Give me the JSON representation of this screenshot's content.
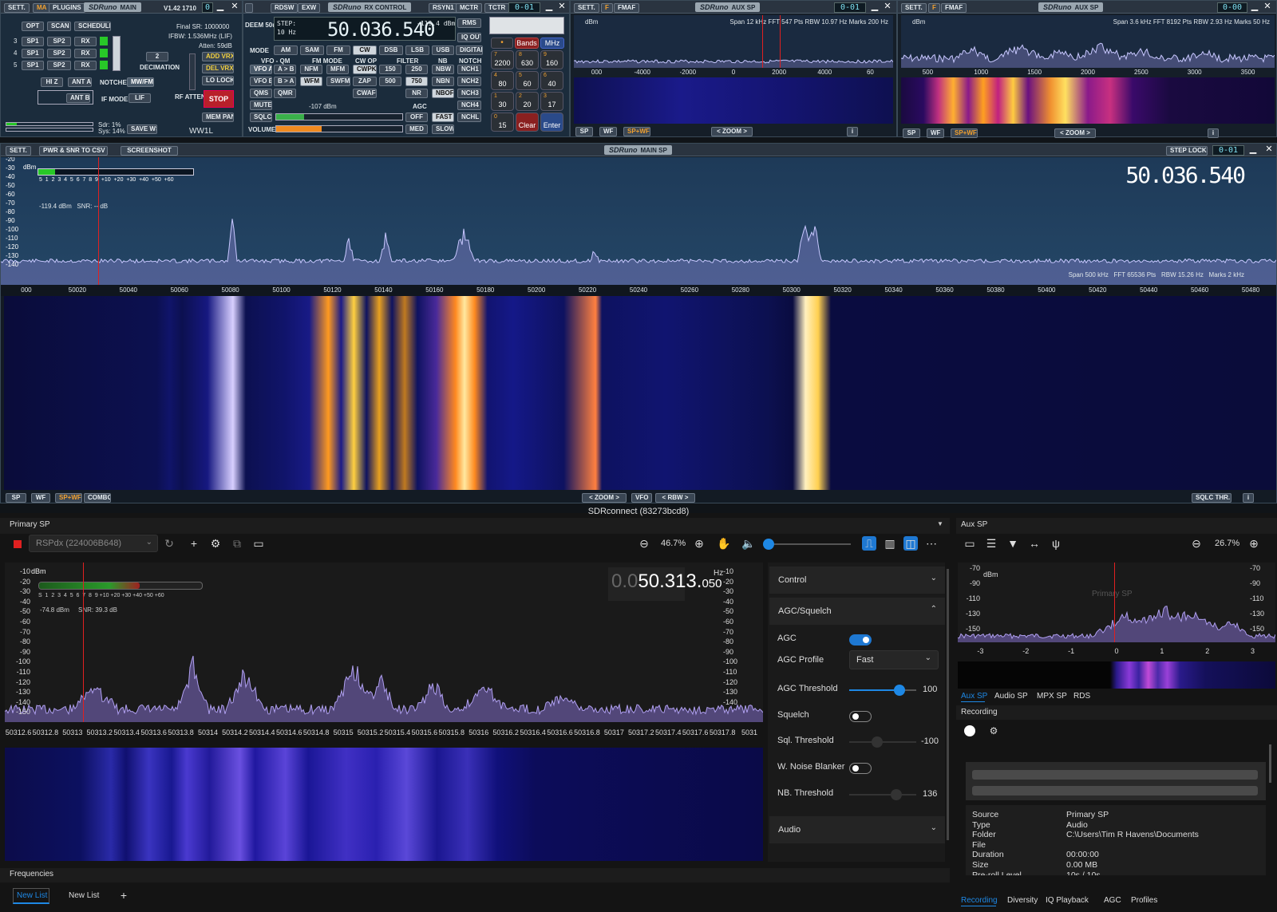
{
  "main": {
    "sett": "SETT.",
    "ma": "MA",
    "plugins": "PLUGINS",
    "brand": "SDRuno",
    "title": "MAIN",
    "version": "V1.42 1710",
    "digit": "0",
    "buttons": [
      "OPT",
      "SCAN",
      "SCHEDULER"
    ],
    "rows": [
      {
        "n": "3",
        "a": "SP1",
        "b": "SP2",
        "c": "RX"
      },
      {
        "n": "4",
        "a": "SP1",
        "b": "SP2",
        "c": "RX"
      },
      {
        "n": "5",
        "a": "SP1",
        "b": "SP2",
        "c": "RX"
      }
    ],
    "final_sr": "Final SR: 1000000",
    "ifbw": "IFBW: 1.536MHz (LIF)",
    "atten": "Atten: 59dB",
    "decim_val": "2",
    "decim": "DECIMATION",
    "add_vrx": "ADD VRX",
    "del_vrx": "DEL VRX",
    "lo_lock": "LO LOCK",
    "hiz": "HI Z",
    "ant_a": "ANT A",
    "notches": "NOTCHES",
    "mwfm": "MW/FM",
    "ant_b": "ANT B",
    "if_mode": "IF MODE",
    "lif": "LIF",
    "rf_atten": "RF ATTEN",
    "stop": "STOP",
    "mem_pan": "MEM PAN",
    "sdr": "Sdr: 1%",
    "sys": "Sys: 14%",
    "save_ws": "SAVE WS",
    "callsign": "WW1L"
  },
  "rx": {
    "deem": "DEEM 50u",
    "rdsw": "RDSW",
    "exw": "EXW",
    "title": "RX CONTROL",
    "rsyn": "RSYN1",
    "mctr": "MCTR",
    "tctr": "TCTR",
    "step": "STEP:",
    "step_val": "10 Hz",
    "freq": "50.036.540",
    "dbm": "-119.4 dBm",
    "rms": "RMS",
    "iq_out": "IQ OUT",
    "digital": "DIGITAL",
    "mode": "MODE",
    "modes": [
      "AM",
      "SAM",
      "FM",
      "CW",
      "DSB",
      "LSB",
      "USB"
    ],
    "vfo_qm": "VFO - QM",
    "pm_mode": "FM MODE",
    "cw_op": "CW OP",
    "filter": "FILTER",
    "nb": "NB",
    "notch": "NOTCH",
    "vfo_a": "VFO A",
    "atob": "A > B",
    "nfm": "NFM",
    "mfm": "MFM",
    "cwpk": "CWPK",
    "f150": "150",
    "f250": "250",
    "nbw": "NBW",
    "nch1": "NCH1",
    "vfo_b": "VFO B",
    "btoa": "B > A",
    "wfm": "WFM",
    "swfm": "SWFM",
    "zap": "ZAP",
    "f500": "500",
    "f750": "750",
    "nbn": "NBN",
    "nch2": "NCH2",
    "qms": "QMS",
    "qmr": "QMR",
    "cwafc": "CWAFC",
    "nr": "NR",
    "nboff": "NBOFF",
    "nch3": "NCH3",
    "mute": "MUTE",
    "sql_dbm": "-107 dBm",
    "agc": "AGC",
    "nch4": "NCH4",
    "sqlc": "SQLC",
    "off": "OFF",
    "fast": "FAST",
    "nchl": "NCHL",
    "volume": "VOLUME",
    "med": "MED",
    "slow": "SLOW"
  },
  "keypad": {
    "bands": "Bands",
    "mhz": "MHz",
    "keys": [
      {
        "n": "7",
        "l": "2200"
      },
      {
        "n": "8",
        "l": "630"
      },
      {
        "n": "9",
        "l": "160"
      },
      {
        "n": "4",
        "l": "80"
      },
      {
        "n": "5",
        "l": "60"
      },
      {
        "n": "6",
        "l": "40"
      },
      {
        "n": "1",
        "l": "30"
      },
      {
        "n": "2",
        "l": "20"
      },
      {
        "n": "3",
        "l": "17"
      },
      {
        "n": "0",
        "l": "15"
      },
      {
        "n": "",
        "l": "Clear"
      },
      {
        "n": "",
        "l": "Enter"
      }
    ]
  },
  "aux1": {
    "sett": "SETT.",
    "f": "F",
    "fmaf": "FMAF",
    "brand": "SDRuno",
    "title": "AUX SP",
    "digit": "0-01",
    "dbm": "dBm",
    "info": "Span 12 kHz   FFT 547 Pts   RBW 10.97 Hz   Marks 200 Hz",
    "ticks": [
      "000",
      "-4000",
      "-2000",
      "0",
      "2000",
      "4000",
      "60"
    ],
    "sp": "SP",
    "wf": "WF",
    "spwf": "SP+WF",
    "zoom": "ZOOM",
    "i": "i"
  },
  "aux2": {
    "sett": "SETT.",
    "f": "F",
    "fmaf": "FMAF",
    "brand": "SDRuno",
    "title": "AUX SP",
    "digit": "0-00",
    "dbm": "dBm",
    "info": "Span 3.6 kHz   FFT 8192 Pts   RBW 2.93 Hz   Marks 50 Hz",
    "ticks": [
      "500",
      "1000",
      "1500",
      "2000",
      "2500",
      "3000",
      "3500"
    ],
    "sp": "SP",
    "wf": "WF",
    "spwf": "SP+WF",
    "zoom": "ZOOM",
    "i": "i"
  },
  "mainsp": {
    "sett": "SETT.",
    "pwr": "PWR & SNR TO CSV",
    "screenshot": "SCREENSHOT",
    "brand": "SDRuno",
    "title": "MAIN SP",
    "step_lock": "STEP LOCK",
    "digit": "0-01",
    "freq": "50.036.540",
    "dbm_label": "dBm",
    "smeter": "5  1  2  3  4  5  6  7  8  9  +10  +20  +30  +40  +50  +60",
    "readout": "-119.4 dBm   SNR: -- dB",
    "yticks": [
      "-20",
      "-30",
      "-40",
      "-50",
      "-60",
      "-70",
      "-80",
      "-90",
      "-100",
      "-110",
      "-120",
      "-130",
      "-140"
    ],
    "info": "Span 500 kHz   FFT 65536 Pts   RBW 15.26 Hz   Marks 2 kHz",
    "xticks": [
      "000",
      "50020",
      "50040",
      "50060",
      "50080",
      "50100",
      "50120",
      "50140",
      "50160",
      "50180",
      "50200",
      "50220",
      "50240",
      "50260",
      "50280",
      "50300",
      "50320",
      "50340",
      "50360",
      "50380",
      "50400",
      "50420",
      "50440",
      "50460",
      "50480"
    ],
    "sp": "SP",
    "wf": "WF",
    "spwf": "SP+WF",
    "combo": "COMBO",
    "zoom": "ZOOM",
    "vfo": "VFO",
    "rbw": "RBW",
    "sqlc_thr": "SQLC THR.",
    "i": "i"
  },
  "sc": {
    "title": "SDRconnect (83273bcd8)",
    "primary_sp": "Primary SP",
    "device": "RSPdx (224006B648)",
    "zoom_pct": "46.7%",
    "freq_dim": "0.0",
    "freq": "50.313.",
    "freq_small": "050",
    "hz": "Hz",
    "dbm_label": "dBm",
    "smeter": "S  1  2  3  4  5  6  7  8  9 +10 +20 +30 +40 +50 +60",
    "readout": "-74.8 dBm     SNR: 39.3 dB",
    "yticks": [
      "-10",
      "-20",
      "-30",
      "-40",
      "-50",
      "-60",
      "-70",
      "-80",
      "-90",
      "-100",
      "-110",
      "-120",
      "-130",
      "-140",
      "-150"
    ],
    "yticks_r": [
      "-10",
      "-20",
      "-30",
      "-40",
      "-50",
      "-60",
      "-70",
      "-80",
      "-90",
      "-100",
      "-110",
      "-120",
      "-130",
      "-140"
    ],
    "xticks": [
      "50312.6",
      "50312.8",
      "50313",
      "50313.2",
      "50313.4",
      "50313.6",
      "50313.8",
      "50314",
      "50314.2",
      "50314.4",
      "50314.6",
      "50314.8",
      "50315",
      "50315.2",
      "50315.4",
      "50315.6",
      "50315.8",
      "50316",
      "50316.2",
      "50316.4",
      "50316.6",
      "50316.8",
      "50317",
      "50317.2",
      "50317.4",
      "50317.6",
      "50317.8",
      "5031"
    ],
    "control": "Control",
    "agc_squelch": "AGC/Squelch",
    "agc": "AGC",
    "agc_profile": "AGC Profile",
    "agc_profile_val": "Fast",
    "agc_threshold": "AGC Threshold",
    "agc_threshold_val": "100",
    "squelch": "Squelch",
    "sql_threshold": "Sql. Threshold",
    "sql_threshold_val": "-100",
    "w_noise": "W. Noise Blanker",
    "nb_threshold": "NB. Threshold",
    "nb_threshold_val": "136",
    "audio": "Audio",
    "frequencies": "Frequencies",
    "new_list_1": "New List",
    "new_list_2": "New List",
    "aux_sp": "Aux SP",
    "aux_zoom": "26.7%",
    "aux_dbm": "dBm",
    "aux_yticks": [
      "-70",
      "-90",
      "-110",
      "-130",
      "-150"
    ],
    "aux_yticks_r": [
      "-70",
      "-90",
      "-110",
      "-130",
      "-150"
    ],
    "aux_xticks": [
      "-3",
      "-2",
      "-1",
      "0",
      "1",
      "2",
      "3"
    ],
    "aux_watermark": "Primary SP",
    "aux_tabs": [
      "Aux SP",
      "Audio SP",
      "MPX SP",
      "RDS"
    ],
    "recording": "Recording",
    "rec_rows": [
      {
        "k": "Source",
        "v": "Primary SP"
      },
      {
        "k": "Type",
        "v": "Audio"
      },
      {
        "k": "Folder",
        "v": "C:\\Users\\Tim R Havens\\Documents"
      },
      {
        "k": "File",
        "v": ""
      },
      {
        "k": "Duration",
        "v": "00:00:00"
      },
      {
        "k": "Size",
        "v": "0.00 MB"
      },
      {
        "k": "Pre-roll Level",
        "v": "10s / 10s"
      }
    ],
    "bottom_tabs": [
      "Recording",
      "Diversity",
      "IQ Playback",
      "AGC",
      "Profiles"
    ]
  },
  "colors": {
    "sdruno_panel": "#1b2c3c",
    "spectrum_bg": "#1e3550",
    "trace": "#c8c8ff",
    "accent": "#1e88e5",
    "stop": "#b8202a",
    "lcd": "#7fe0f0"
  }
}
